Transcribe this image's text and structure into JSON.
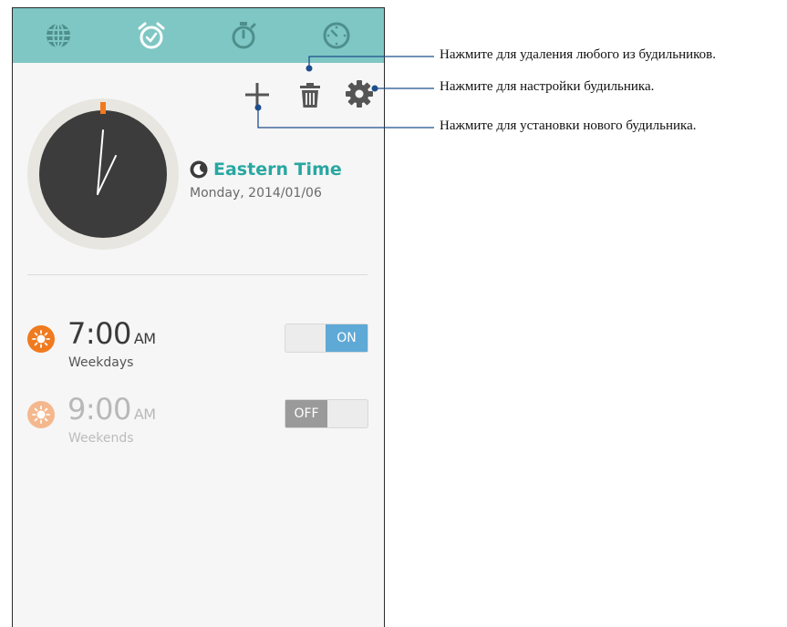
{
  "colors": {
    "tabbar": "#7fc7c4",
    "accent_teal": "#29a7a1",
    "alarm_on_icon": "#f07a1f",
    "alarm_off_icon": "#f5b88e",
    "toggle_on": "#5fa9d6",
    "toggle_off": "#9a9a9a",
    "callout_line": "#1f4e8c"
  },
  "tabs": [
    {
      "icon": "globe-icon",
      "label": "World clock"
    },
    {
      "icon": "alarm-clock-icon",
      "label": "Alarm"
    },
    {
      "icon": "stopwatch-icon",
      "label": "Stopwatch"
    },
    {
      "icon": "timer-icon",
      "label": "Timer"
    }
  ],
  "toolbar": {
    "add_icon": "plus-icon",
    "delete_icon": "trash-icon",
    "settings_icon": "gear-icon"
  },
  "clock": {
    "timezone_icon": "moon-icon",
    "timezone_name": "Eastern Time",
    "date": "Monday, 2014/01/06"
  },
  "alarms": [
    {
      "time": "7:00",
      "ampm": "AM",
      "days": "Weekdays",
      "toggle": "ON",
      "enabled": true,
      "icon": "sun-icon"
    },
    {
      "time": "9:00",
      "ampm": "AM",
      "days": "Weekends",
      "toggle": "OFF",
      "enabled": false,
      "icon": "sun-icon"
    }
  ],
  "callouts": {
    "delete": "Нажмите для удаления любого из будильников.",
    "settings": "Нажмите для настройки будильника.",
    "add": "Нажмите для установки нового будильника."
  }
}
